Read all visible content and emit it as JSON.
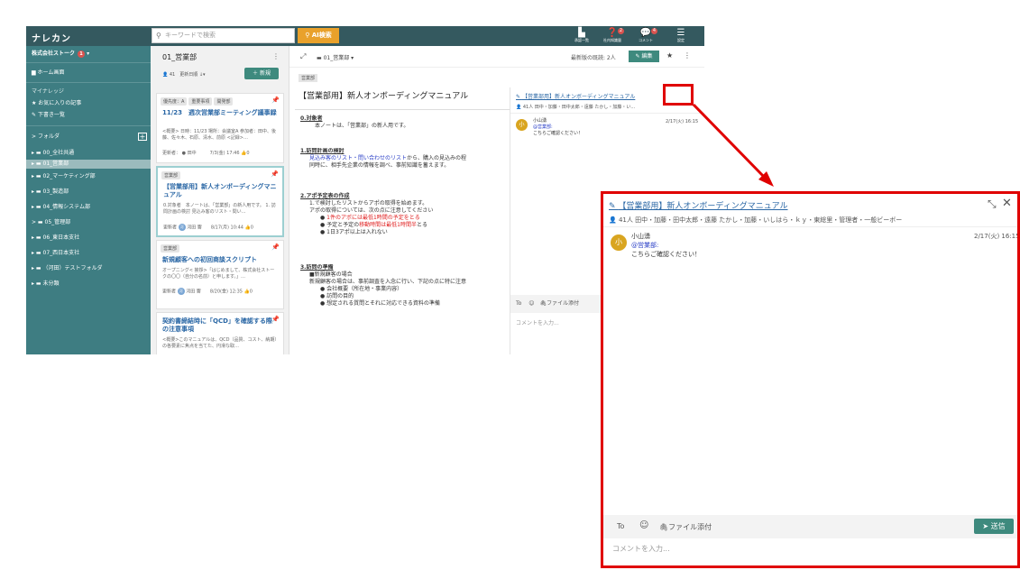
{
  "app": {
    "logo": "ナレカン",
    "search_placeholder": "キーワードで検索",
    "ai_button": "AI検索",
    "top_icons": [
      {
        "label": "承認一覧",
        "icon": "approval-icon"
      },
      {
        "label": "社内知識量",
        "icon": "question-icon",
        "badge": "2"
      },
      {
        "label": "コメント",
        "icon": "comment-icon",
        "badge": "4"
      },
      {
        "label": "設定",
        "icon": "menu-icon"
      }
    ]
  },
  "sidebar": {
    "company": "株式会社ストーク",
    "company_badge": "1",
    "home": "ホーム画面",
    "my_knowledge": "マイナレッジ",
    "favorites": "お気に入りの記事",
    "drafts": "下書き一覧",
    "folders_label": "フォルダ",
    "folders": [
      "00_全社共通",
      "01_営業部",
      "02_マーケティング部",
      "03_製造部",
      "04_情報システム部",
      "05_管理部",
      "06_東日本支社",
      "07_西日本支社",
      "（河田）テストフォルダ",
      "未分類"
    ]
  },
  "list": {
    "title": "01_営業部",
    "count": "41",
    "sort": "更新日順",
    "new_button": "＋ 新規",
    "cards": [
      {
        "tags": [
          "優先度：A",
          "重要事項",
          "開発部"
        ],
        "title": "11/23　週次営業部ミーティング議事録",
        "body": "<概要> 日時：11/23 場所：会議室A 参加者：田中、後藤、佐々木、石原、清水、前原 <記録>…",
        "updater": "更新者：",
        "user": "田中",
        "date": "7/3(金) 17:46",
        "likes": "0"
      },
      {
        "tags": [
          "営業部"
        ],
        "title": "【営業部用】新人オンボーディングマニュアル",
        "body": "0.対象者　本ノートは、「営業部」の新人用です。 1. 訪問計画の検討 見込み客のリスト・問い…",
        "updater": "更新者",
        "user": "河田 響",
        "date": "8/17(月) 10:44",
        "likes": "0"
      },
      {
        "tags": [
          "営業部"
        ],
        "title": "新規顧客への初回商談スクリプト",
        "body": "オープニング< 挨拶>「はじめまして、株式会社ストークの〇〇（自分の名前）と申します。」…",
        "updater": "更新者",
        "user": "河田 響",
        "date": "8/20(金) 12:35",
        "likes": "0"
      },
      {
        "tags": [],
        "title": "契約書締結時に「QCD」を確認する際の注意事項",
        "body": "<概要>このマニュアルは、QCD（品質、コスト、納期）の各要素に焦点を当てた、円滑な取…",
        "updater": "",
        "user": "",
        "date": "",
        "likes": ""
      }
    ]
  },
  "main": {
    "breadcrumb": "01_営業部",
    "readers": "最新版の既読: 2人",
    "edit": "編集",
    "tag": "営業部",
    "title": "【営業部用】新人オンボーディングマニュアル",
    "s0_head": "0.対象者",
    "s0_text": "本ノートは、「営業部」の新人用です。",
    "s1_head": "1.訪問計画の検討",
    "s1_link": "見込み客のリスト・問い合わせのリスト",
    "s1_text1": "から、購入の見込みの程",
    "s1_text2": "同時に、相手先企業の情報を調べ、事前知識を蓄えます。",
    "s2_head": "2.アポ予定表の作成",
    "s2_l1": "1.で検討したリストからアポの取得を始めます。",
    "s2_l2": "アポの取得については、次の点に注意してください",
    "s2_b1": "1件のアポには最低1時間の予定をとる",
    "s2_b2a": "予定と予定の",
    "s2_b2b": "移動時間は最低1時間半",
    "s2_b2c": "とる",
    "s2_b3": "1日3アポ以上は入れない",
    "s3_head": "3.訪問の準備",
    "s3_l1": "■新規顧客の場合",
    "s3_l2": "新規顧客の場合は、事前調査を入念に行い、下記の点に特に注意",
    "s3_b1": "会社概要（所在地・事業内容）",
    "s3_b2": "訪問の目的",
    "s3_b3": "想定される質問とそれに対応できる資料の準備"
  },
  "comment_panel": {
    "title": "【営業部用】新人オンボーディングマニュアル",
    "members_short": "41人 田中・加藤・田中太郎・遠藤 たかし・加藤・い...",
    "members": "41人 田中・加藤・田中太郎・遠藤 たかし・加藤・いしはら・ｋｙ・東総里・管理者・一般ビーボー",
    "author": "小山湧",
    "avatar": "小",
    "date_short": "2/17(火) 16:15",
    "date": "2/17(火) 16:15",
    "mention": "@営業部:",
    "message": "こちらご確認ください！",
    "to": "To",
    "attach": "ファイル添付",
    "send": "送信",
    "placeholder": "コメントを入力..."
  },
  "colors": {
    "topbar": "#34595f",
    "sidebar": "#3e7d82",
    "accent": "#e9a12b",
    "highlight": "#e00000"
  }
}
